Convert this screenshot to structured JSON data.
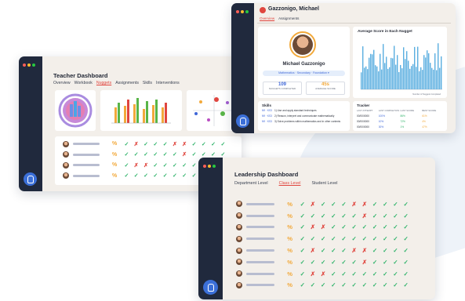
{
  "teacher": {
    "title": "Teacher Dashboard",
    "tabs": [
      "Overview",
      "Workbook",
      "Nuggets",
      "Assignments",
      "Skills",
      "Interventions"
    ],
    "active_tab": 2,
    "rows": [
      [
        "%",
        "✓",
        "✗",
        "✓",
        "✓",
        "✓",
        "✗",
        "✗",
        "✓",
        "✓",
        "✓",
        "✓"
      ],
      [
        "%",
        "✓",
        "✓",
        "✓",
        "✓",
        "✓",
        "✓",
        "✗",
        "✓",
        "✓",
        "✓",
        "✓"
      ],
      [
        "%",
        "✓",
        "✗",
        "✗",
        "✓",
        "✓",
        "✓",
        "✓",
        "✓",
        "✓",
        "✓",
        "✓"
      ],
      [
        "%",
        "✓",
        "✓",
        "✓",
        "✓",
        "✓",
        "✓",
        "✓",
        "✓",
        "✓",
        "✓",
        "✓"
      ]
    ]
  },
  "student": {
    "name_header": "Gazzonigo, Michael",
    "tabs": [
      "Overview",
      "Assignments"
    ],
    "profile_name": "Michael Gazzonigo",
    "pill": "Mathematics · Secondary · Foundation ▾",
    "stat1_value": "109",
    "stat1_label": "NUGGETS COMPLETED",
    "stat2_value": "45s",
    "stat2_label": "AVERAGE SCORE",
    "chart_title": "Average Score in Each Nugget",
    "chart_xlabel": "Number of Nuggets Completed",
    "skills_title": "Skills",
    "skills": [
      {
        "code": "N9 · KS3",
        "text": "1) Use and apply standard techniques"
      },
      {
        "code": "N9 · KS3",
        "text": "2) Reason, interpret and communicate mathematically"
      },
      {
        "code": "N9 · KS3",
        "text": "3) Solve problems within mathematics and in other contexts"
      }
    ],
    "tracker_title": "Tracker",
    "tracker_headers": [
      "LAST ATTEMPT",
      "LAST COMPLETION",
      "LAST SCORE",
      "BEST SCORE"
    ],
    "tracker_rows": [
      [
        "00/00/0000",
        "100%",
        "86%",
        "61%"
      ],
      [
        "00/00/0000",
        "10%",
        "72%",
        "4%"
      ],
      [
        "00/00/0000",
        "30%",
        "1%",
        "47%"
      ]
    ]
  },
  "leadership": {
    "title": "Leadership Dashboard",
    "tabs": [
      "Department Level",
      "Class Level",
      "Student Level"
    ],
    "active_tab": 1,
    "rows": [
      [
        "%",
        "✓",
        "✗",
        "✓",
        "✓",
        "✓",
        "✗",
        "✗",
        "✓",
        "✓",
        "✓",
        "✓"
      ],
      [
        "%",
        "✓",
        "✓",
        "✓",
        "✓",
        "✓",
        "✓",
        "✗",
        "✓",
        "✓",
        "✓",
        "✓"
      ],
      [
        "%",
        "✓",
        "✗",
        "✗",
        "✓",
        "✓",
        "✓",
        "✓",
        "✓",
        "✓",
        "✓",
        "✓"
      ],
      [
        "%",
        "✓",
        "✓",
        "✓",
        "✓",
        "✓",
        "✓",
        "✓",
        "✓",
        "✓",
        "✓",
        "✓"
      ],
      [
        "%",
        "✓",
        "✗",
        "✓",
        "✓",
        "✓",
        "✗",
        "✗",
        "✓",
        "✓",
        "✓",
        "✓"
      ],
      [
        "%",
        "✓",
        "✓",
        "✓",
        "✓",
        "✓",
        "✓",
        "✗",
        "✓",
        "✓",
        "✓",
        "✓"
      ],
      [
        "%",
        "✓",
        "✗",
        "✗",
        "✓",
        "✓",
        "✓",
        "✓",
        "✓",
        "✓",
        "✓",
        "✓"
      ],
      [
        "%",
        "✓",
        "✓",
        "✓",
        "✓",
        "✓",
        "✓",
        "✓",
        "✓",
        "✓",
        "✓",
        "✓"
      ]
    ]
  },
  "colors": {
    "rail": "#20293d",
    "accent": "#e0463f",
    "check": "#2fb36a",
    "cross": "#e0463f",
    "percent": "#f2a93b",
    "bar": "#5aaee0"
  }
}
